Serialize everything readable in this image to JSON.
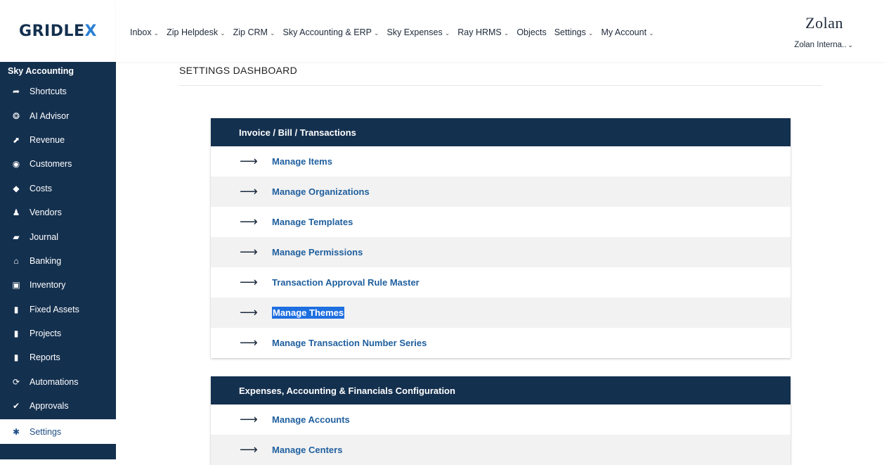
{
  "logo": {
    "prefix": "GRIDLE",
    "accent": "X"
  },
  "sidebar": {
    "heading": "Sky Accounting",
    "items": [
      {
        "label": "Shortcuts",
        "icon": "share-arrow-icon",
        "glyph": "➦"
      },
      {
        "label": "AI Advisor",
        "icon": "brain-icon",
        "glyph": "❂"
      },
      {
        "label": "Revenue",
        "icon": "growth-chart-icon",
        "glyph": "⬈"
      },
      {
        "label": "Customers",
        "icon": "user-circle-icon",
        "glyph": "◉"
      },
      {
        "label": "Costs",
        "icon": "tag-icon",
        "glyph": "◆"
      },
      {
        "label": "Vendors",
        "icon": "vendors-icon",
        "glyph": "♟"
      },
      {
        "label": "Journal",
        "icon": "book-icon",
        "glyph": "▰"
      },
      {
        "label": "Banking",
        "icon": "bank-icon",
        "glyph": "⌂"
      },
      {
        "label": "Inventory",
        "icon": "clipboard-icon",
        "glyph": "▣"
      },
      {
        "label": "Fixed Assets",
        "icon": "file-icon",
        "glyph": "▮"
      },
      {
        "label": "Projects",
        "icon": "file-icon",
        "glyph": "▮"
      },
      {
        "label": "Reports",
        "icon": "report-icon",
        "glyph": "▮"
      },
      {
        "label": "Automations",
        "icon": "sync-icon",
        "glyph": "⟳"
      },
      {
        "label": "Approvals",
        "icon": "check-circle-icon",
        "glyph": "✔"
      },
      {
        "label": "Settings",
        "icon": "gear-icon",
        "glyph": "✱",
        "active": true
      }
    ]
  },
  "topnav": {
    "items": [
      {
        "label": "Inbox"
      },
      {
        "label": "Zip Helpdesk"
      },
      {
        "label": "Zip CRM"
      },
      {
        "label": "Sky Accounting & ERP"
      },
      {
        "label": "Sky Expenses"
      },
      {
        "label": "Ray HRMS"
      },
      {
        "label": "Objects",
        "nochev": true
      },
      {
        "label": "Settings"
      },
      {
        "label": "My Account"
      }
    ],
    "chevron": "⌄"
  },
  "brand": "Zolan",
  "org": "Zolan Interna..",
  "page_title": "SETTINGS DASHBOARD",
  "sections": [
    {
      "title": "Invoice / Bill / Transactions",
      "items": [
        "Manage Items",
        "Manage Organizations",
        "Manage Templates",
        "Manage Permissions",
        "Transaction Approval Rule Master",
        "Manage Themes",
        "Manage Transaction Number Series"
      ],
      "selected_index": 5
    },
    {
      "title": "Expenses, Accounting & Financials Configuration",
      "items": [
        "Manage Accounts",
        "Manage Centers"
      ]
    }
  ],
  "arrow_glyph": "⟶",
  "colors": {
    "navy": "#14304f",
    "link": "#1f5f9e",
    "selection": "#1e6fe0"
  }
}
